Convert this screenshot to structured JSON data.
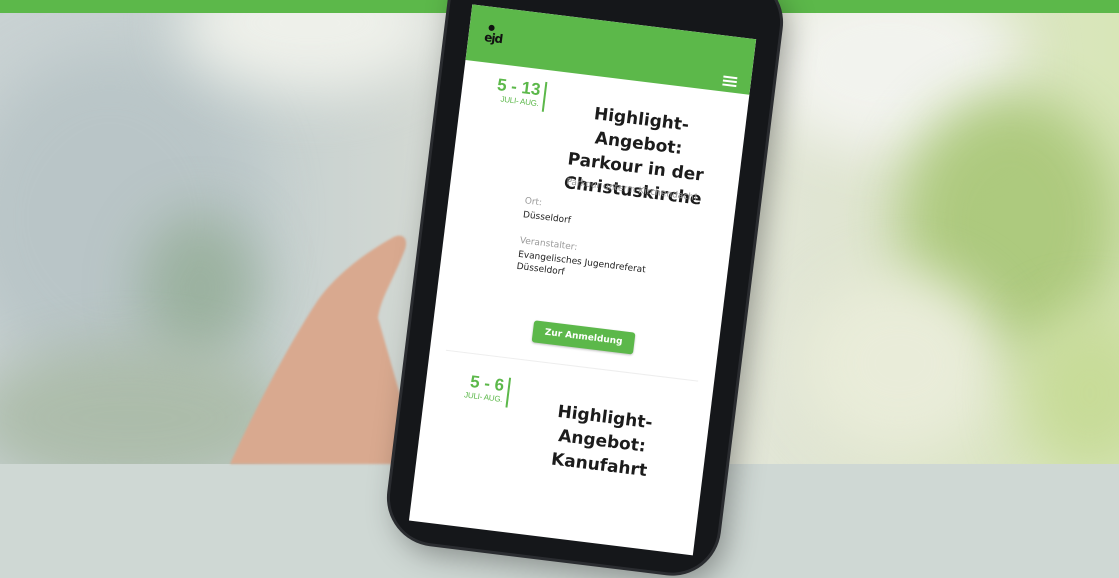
{
  "colors": {
    "accent": "#5cb84a"
  },
  "logo": {
    "text": "ejd"
  },
  "header": {
    "menu_icon": "hamburger-icon"
  },
  "events": [
    {
      "date_days": "5 - 13",
      "date_months": "JULI- AUG.",
      "title_lines": [
        "Highlight-Angebot:",
        "Parkour in der",
        "Christuskirche"
      ],
      "subtitle": "Parkour unterm Kirchendach!",
      "location_label": "Ort:",
      "location": "Düsseldorf",
      "organizer_label": "Veranstalter:",
      "organizer_lines": [
        "Evangelisches Jugendreferat",
        "Düsseldorf"
      ],
      "button_label": "Zur Anmeldung"
    },
    {
      "date_days": "5 - 6",
      "date_months": "JULI- AUG.",
      "title_lines": [
        "Highlight-Angebot:",
        "Kanufahrt"
      ]
    }
  ]
}
